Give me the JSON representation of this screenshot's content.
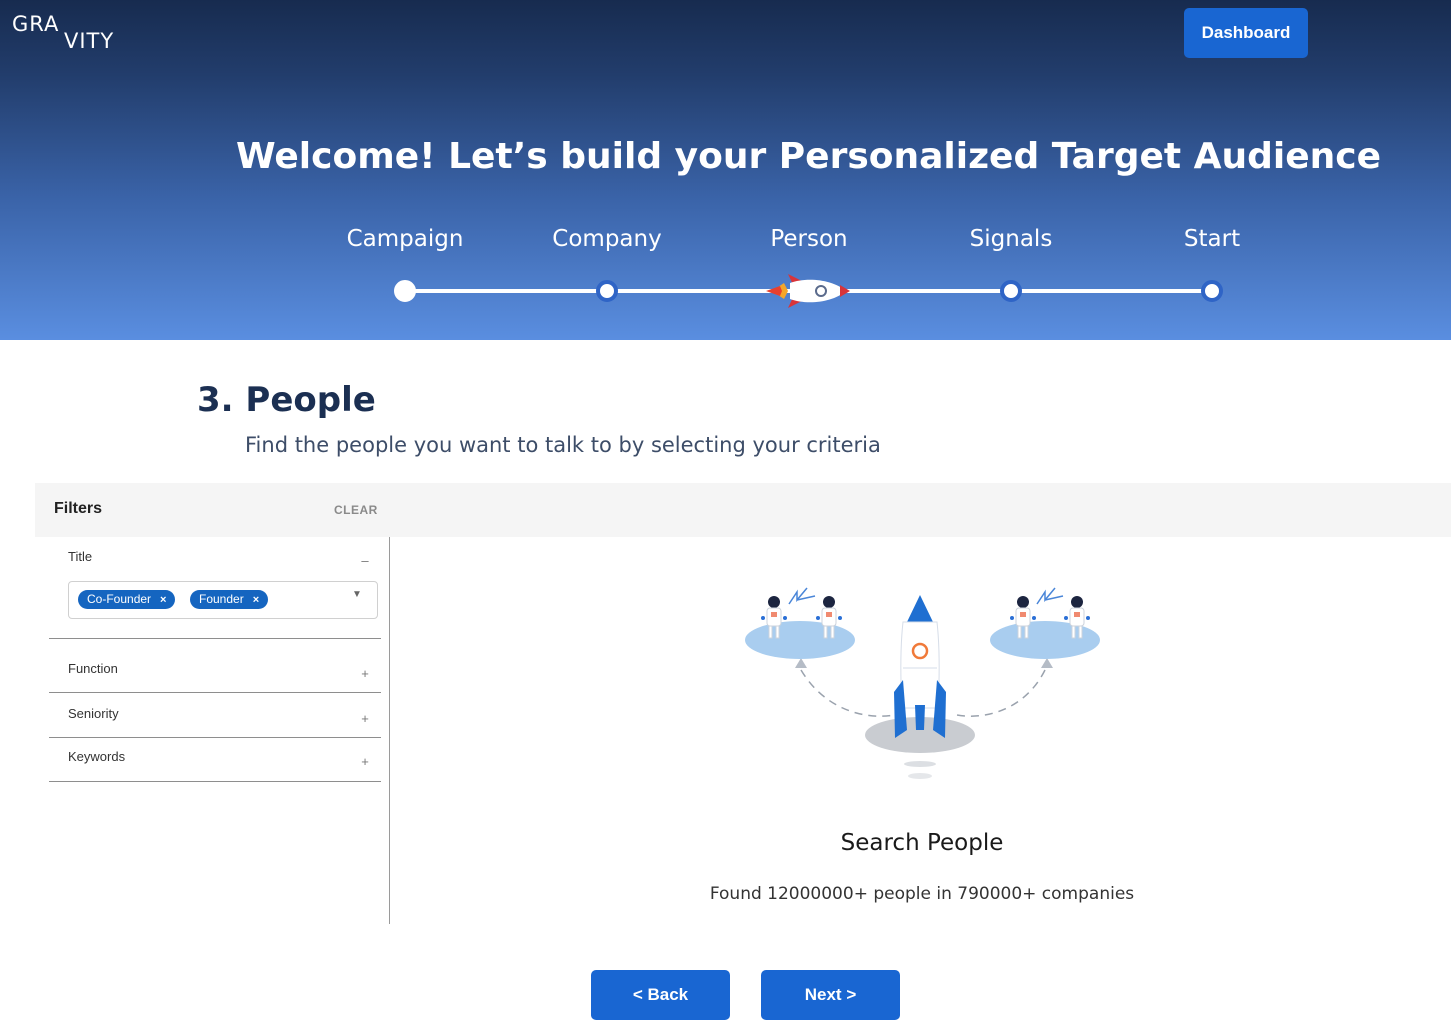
{
  "header": {
    "logo": {
      "line1": "GRA",
      "line2": "VITY"
    },
    "dashboard_label": "Dashboard",
    "welcome": "Welcome! Let’s build your Personalized Target Audience"
  },
  "steps": [
    "Campaign",
    "Company",
    "Person",
    "Signals",
    "Start"
  ],
  "current_step": "Person",
  "section": {
    "title": "3. People",
    "subtitle": "Find the people you want to talk to by selecting your criteria"
  },
  "filters": {
    "label": "Filters",
    "clear_label": "CLEAR",
    "title_facet": {
      "label": "Title",
      "toggle": "–",
      "chips": [
        "Co-Founder",
        "Founder"
      ],
      "chip_remove": "×"
    },
    "facets": [
      {
        "label": "Function",
        "toggle": "+"
      },
      {
        "label": "Seniority",
        "toggle": "+"
      },
      {
        "label": "Keywords",
        "toggle": "+"
      }
    ]
  },
  "results": {
    "title": "Search People",
    "found_text": "Found 12000000+ people in 790000+ companies"
  },
  "footer": {
    "back_label": "< Back",
    "next_label": "Next >"
  },
  "colors": {
    "primary_button": "#1966d2",
    "chip": "#1565c0",
    "hero_top": "#172b4f",
    "hero_bottom": "#5a8ee0"
  }
}
